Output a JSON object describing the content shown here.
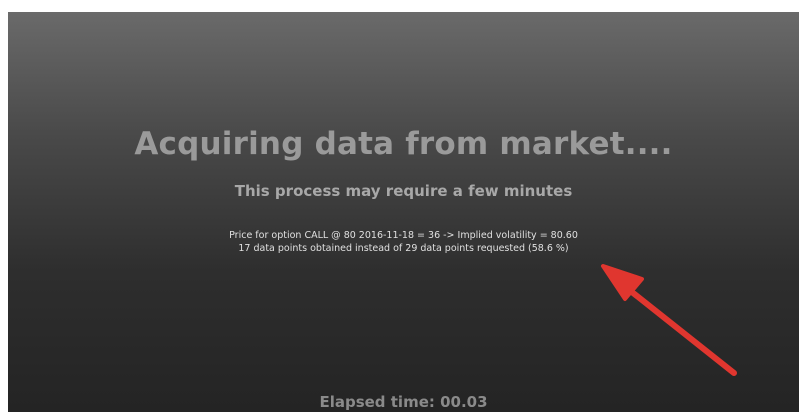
{
  "dialog": {
    "title": "Acquiring data from market....",
    "subtitle": "This process may require a few minutes",
    "status_line_1": "Price for option CALL @ 80 2016-11-18 = 36 -> Implied volatility = 80.60",
    "status_line_2": "17 data points obtained instead of 29 data points requested (58.6 %)",
    "elapsed": "Elapsed time: 00.03"
  },
  "annotation": {
    "icon": "red-arrow-icon",
    "color": "#e0362f"
  },
  "colors": {
    "background_top": "#6a6a6a",
    "background_bottom": "#242424",
    "title_text": "#9a9a9a",
    "status_text": "#e0e0e0"
  }
}
